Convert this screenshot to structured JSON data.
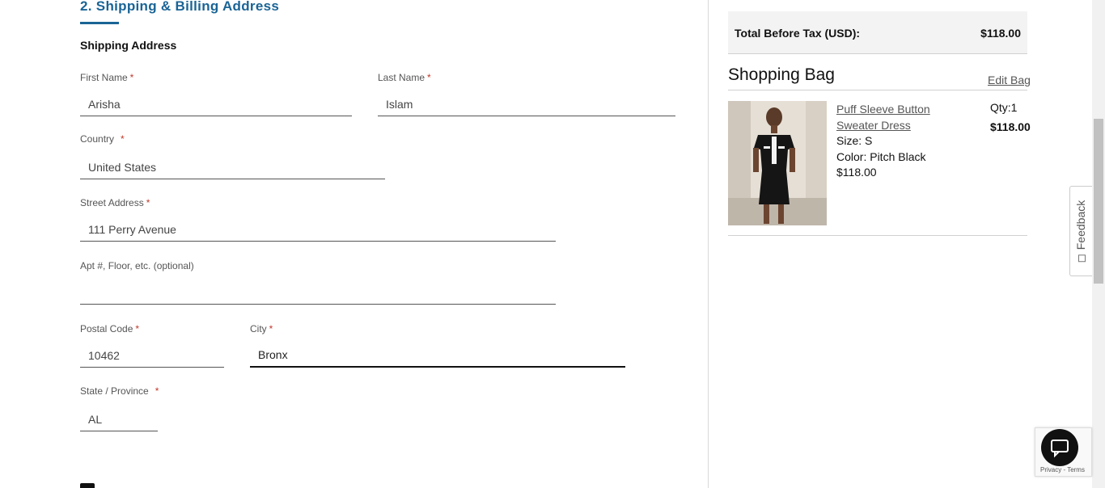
{
  "form": {
    "section_title": "2. Shipping & Billing Address",
    "sub_title": "Shipping Address",
    "required_mark": "*",
    "first_name": {
      "label": "First Name",
      "value": "Arisha"
    },
    "last_name": {
      "label": "Last Name",
      "value": "Islam"
    },
    "country": {
      "label": "Country",
      "value": "United States"
    },
    "street": {
      "label": "Street Address",
      "value": "111 Perry Avenue"
    },
    "apt": {
      "label": "Apt #, Floor, etc. (optional)",
      "value": ""
    },
    "postal": {
      "label": "Postal Code",
      "value": "10462"
    },
    "city": {
      "label": "City",
      "value": "Bronx"
    },
    "state": {
      "label": "State / Province",
      "value": "AL"
    }
  },
  "summary": {
    "total_label": "Total Before Tax (USD):",
    "total_value": "$118.00",
    "bag_title": "Shopping Bag",
    "edit_bag": "Edit Bag",
    "item": {
      "name": "Puff Sleeve Button Sweater Dress",
      "size": "Size: S",
      "color": "Color: Pitch Black",
      "price": "$118.00",
      "qty": "Qty:1",
      "line_total": "$118.00"
    }
  },
  "widgets": {
    "feedback": "Feedback",
    "recaptcha": "Privacy - Terms"
  },
  "icons": {
    "feedback": "feedback-icon",
    "chat": "chat-icon"
  }
}
